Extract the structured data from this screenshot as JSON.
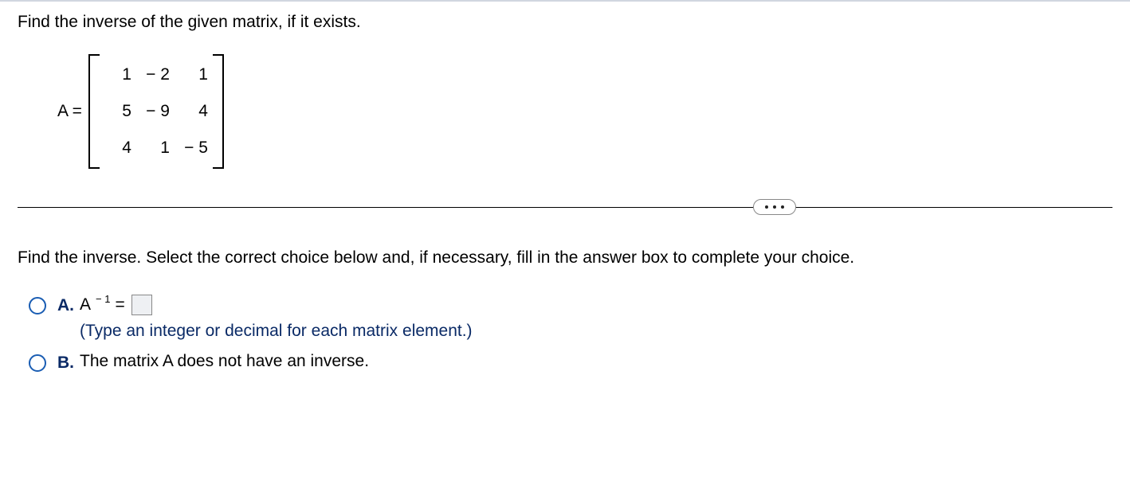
{
  "question": "Find the inverse of the given matrix, if it exists.",
  "matrix_label": "A =",
  "matrix": {
    "rows": [
      [
        "1",
        "− 2",
        "1"
      ],
      [
        "5",
        "− 9",
        "4"
      ],
      [
        "4",
        "1",
        "− 5"
      ]
    ]
  },
  "instruction": "Find the inverse. Select the correct choice below and, if necessary, fill in the answer box to complete your choice.",
  "choices": {
    "a": {
      "letter": "A.",
      "expr_base": "A",
      "expr_sup": "− 1",
      "expr_eq": "=",
      "hint": "(Type an integer or decimal for each matrix element.)"
    },
    "b": {
      "letter": "B.",
      "text": "The matrix A does not have an inverse."
    }
  }
}
